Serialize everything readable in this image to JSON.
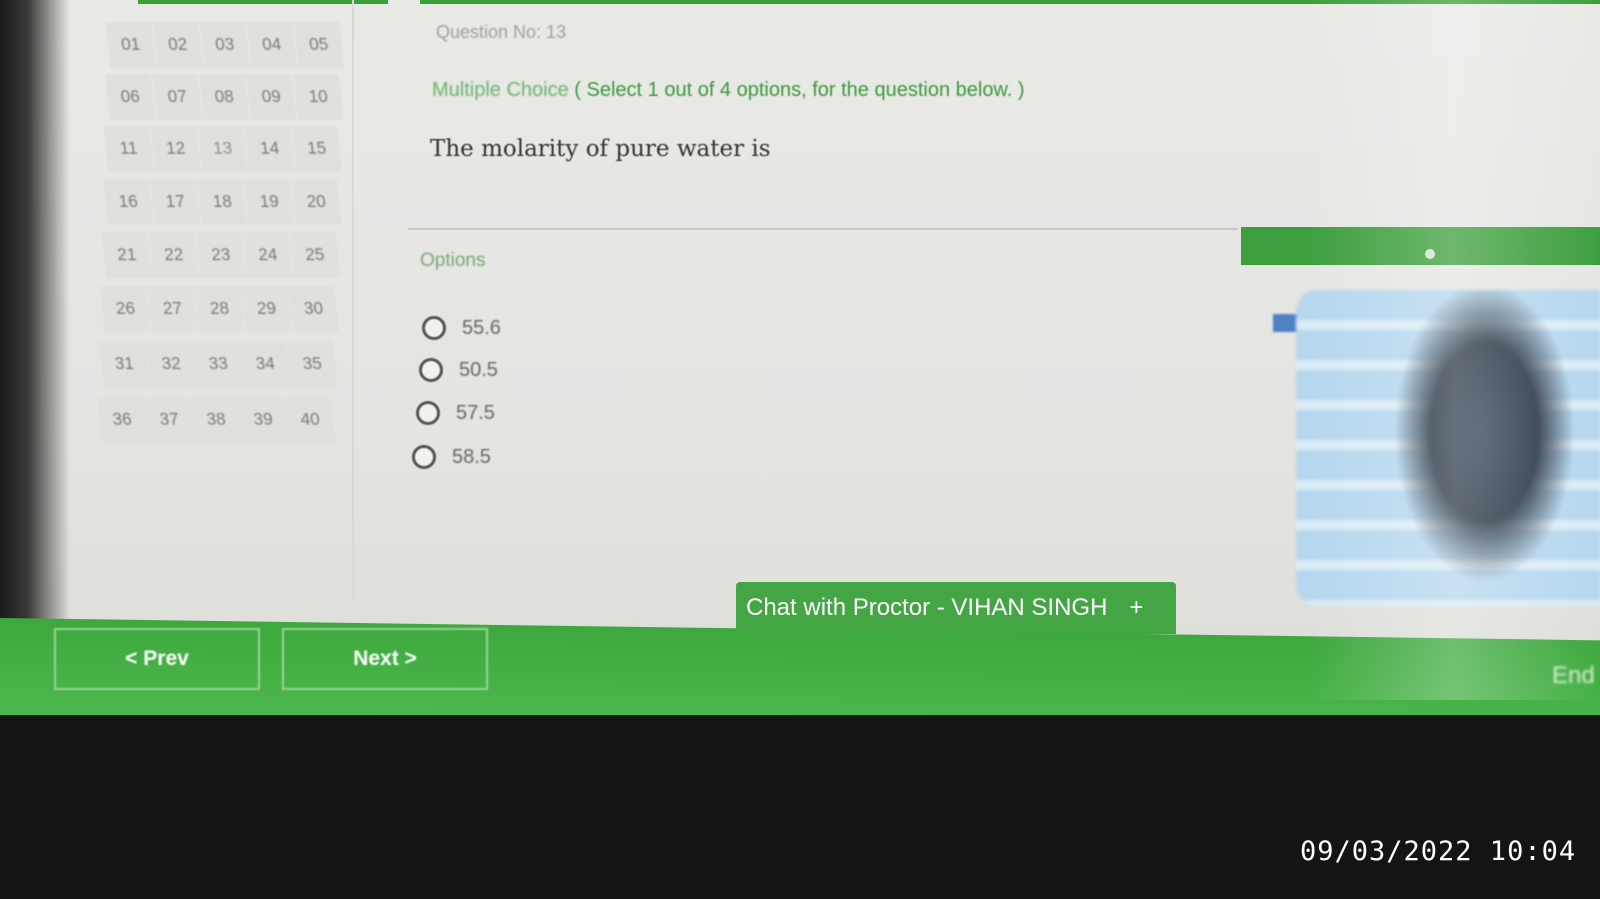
{
  "question_nav": {
    "numbers": [
      "01",
      "02",
      "03",
      "04",
      "05",
      "06",
      "07",
      "08",
      "09",
      "10",
      "11",
      "12",
      "13",
      "14",
      "15",
      "16",
      "17",
      "18",
      "19",
      "20",
      "21",
      "22",
      "23",
      "24",
      "25",
      "26",
      "27",
      "28",
      "29",
      "30",
      "31",
      "32",
      "33",
      "34",
      "35",
      "36",
      "37",
      "38",
      "39",
      "40"
    ],
    "current": "13"
  },
  "question": {
    "number_label": "Question No: 13",
    "type_prefix": "Multiple Choice",
    "type_detail": " ( Select 1 out of 4 options, for the question below. )",
    "text": "The molarity of pure water is"
  },
  "options": {
    "title": "Options",
    "items": [
      "55.6",
      "50.5",
      "57.5",
      "58.5"
    ]
  },
  "buttons": {
    "prev": "< Prev",
    "next": "Next >",
    "end": "End"
  },
  "chat": {
    "label": "Chat with Proctor - VIHAN SINGH",
    "plus": "+"
  },
  "photo_timestamp": "09/03/2022 10:04",
  "colors": {
    "accent_green": "#44a544",
    "background": "#e6e6e3"
  }
}
